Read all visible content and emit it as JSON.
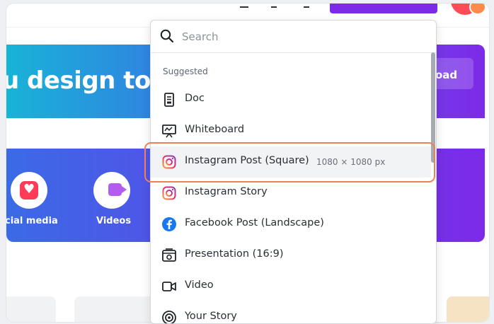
{
  "hero": {
    "title": "u design tod",
    "upload_label": "oad"
  },
  "categories": [
    {
      "label": "cial media",
      "icon": "heart-icon"
    },
    {
      "label": "Videos",
      "icon": "video-icon"
    }
  ],
  "search": {
    "placeholder": "Search"
  },
  "dropdown": {
    "section_label": "Suggested",
    "items": [
      {
        "label": "Doc",
        "icon": "doc-icon"
      },
      {
        "label": "Whiteboard",
        "icon": "whiteboard-icon"
      },
      {
        "label": "Instagram Post (Square)",
        "dimensions": "1080 × 1080 px",
        "icon": "instagram-icon"
      },
      {
        "label": "Instagram Story",
        "icon": "instagram-icon"
      },
      {
        "label": "Facebook Post (Landscape)",
        "icon": "facebook-icon"
      },
      {
        "label": "Presentation (16:9)",
        "icon": "presentation-icon"
      },
      {
        "label": "Video",
        "icon": "video-icon"
      },
      {
        "label": "Your Story",
        "icon": "story-icon"
      }
    ]
  },
  "colors": {
    "accent": "#7d2ae8",
    "highlight": "#f07f54",
    "instagram": "#e1306c",
    "facebook": "#1877f2"
  }
}
